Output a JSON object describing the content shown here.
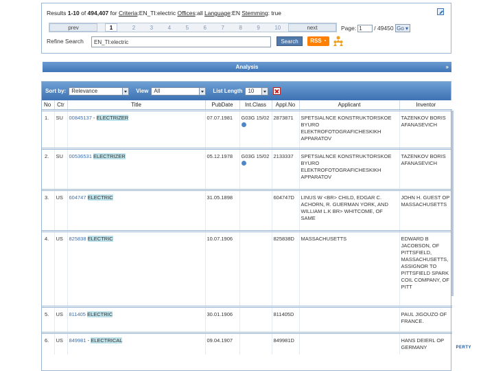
{
  "search": {
    "results_prefix": "Results ",
    "results_range": "1-10",
    "results_of": " of ",
    "results_total": "494,407",
    "results_for": " for ",
    "criteria_label": "Criteria",
    "criteria_value": ":EN_TI:electric ",
    "offices_label": "Offices",
    "offices_value": ":all ",
    "language_label": "Language",
    "language_value": ":EN ",
    "stemming_label": "Stemming",
    "stemming_value": ": true",
    "prev_label": "prev",
    "next_label": "next",
    "pages": [
      "1",
      "2",
      "3",
      "4",
      "5",
      "6",
      "7",
      "8",
      "9",
      "10"
    ],
    "current_page": "1",
    "page_label": "Page:",
    "page_input_value": "1",
    "page_total": "/ 49450",
    "go_label": "Go",
    "refine_label": "Refine Search",
    "refine_value": "EN_TI:electric",
    "search_button": "Search",
    "rss_label": "RSS"
  },
  "analysis": {
    "label": "Analysis",
    "chevron": "»"
  },
  "toolbar": {
    "sort_by_label": "Sort by:",
    "sort_by_value": "Relevance",
    "view_label": "View",
    "view_value": "All",
    "list_length_label": "List Length",
    "list_length_value": "10"
  },
  "columns": [
    "No",
    "Ctr",
    "Title",
    "PubDate",
    "Int.Class",
    "Appl.No",
    "Applicant",
    "Inventor"
  ],
  "rows": [
    {
      "no": "1.",
      "ctr": "SU",
      "number": "00845137",
      "sep": " - ",
      "title": "ELECTRIZER",
      "pubdate": "07.07.1981",
      "int_class": "G03G 15/02",
      "appl_no": "2873871",
      "applicant": "SPETSIALNCE KONSTRUKTORSKOE BYURO ELEKTROFOTOGRAFICHESKIKH APPARATOV",
      "inventor": "TAZENKOV BORIS AFANASEVICH"
    },
    {
      "no": "2.",
      "ctr": "SU",
      "number": "00536531",
      "sep": " ",
      "title": "ELECTRIZER",
      "pubdate": "05.12.1978",
      "int_class": "G03G 15/02",
      "appl_no": "2133337",
      "applicant": "SPETSIALNCE KONSTRUKTORSKOE BYURO ELEKTROFOTOGRAFICHESKIKH APPARATOV",
      "inventor": "TAZENKOV BORIS AFANASEVICH"
    },
    {
      "no": "3.",
      "ctr": "US",
      "number": "604747",
      "sep": " ",
      "title": "ELECTRIC",
      "pubdate": "31.05.1898",
      "int_class": "",
      "appl_no": "604747D",
      "applicant": "LINUS W <BR> CHILD, EDGAR C. ACHORN, R. GUERMAN YORK, AND WILLIAM L.K BR> WHITCOME, OF SAME",
      "inventor": "JOHN H. GUEST OP MASSACHUSETTS"
    },
    {
      "no": "4.",
      "ctr": "US",
      "number": "825838",
      "sep": " ",
      "title": "ELECTRIC",
      "pubdate": "10.07.1906",
      "int_class": "",
      "appl_no": "825838D",
      "applicant": "MASSACHUSETTS",
      "inventor": "EDWARD B JACOBSON, OF PITTSFIELD, MASSACHUSETTS, ASSIGNOR TO PITTSFIELD SPARK COIL COMPANY, OF PITT"
    },
    {
      "no": "5.",
      "ctr": "US",
      "number": "811405",
      "sep": " ",
      "title": "ELECTRIC",
      "pubdate": "30.01.1906",
      "int_class": "",
      "appl_no": "811405D",
      "applicant": "",
      "inventor": "PAUL JIGOUZO OF FRANCE."
    },
    {
      "no": "6.",
      "ctr": "US",
      "number": "849981",
      "sep": " - ",
      "title": "ELECTRICAL",
      "pubdate": "09.04.1907",
      "int_class": "",
      "appl_no": "849981D",
      "applicant": "",
      "inventor": "HANS DEIERL OP GERMANY"
    }
  ],
  "footer_mark": "PERTY",
  "colors": {
    "accent_blue": "#3d72b3",
    "highlight": "#bfe3ea",
    "rss_orange": "#ff7f00"
  }
}
